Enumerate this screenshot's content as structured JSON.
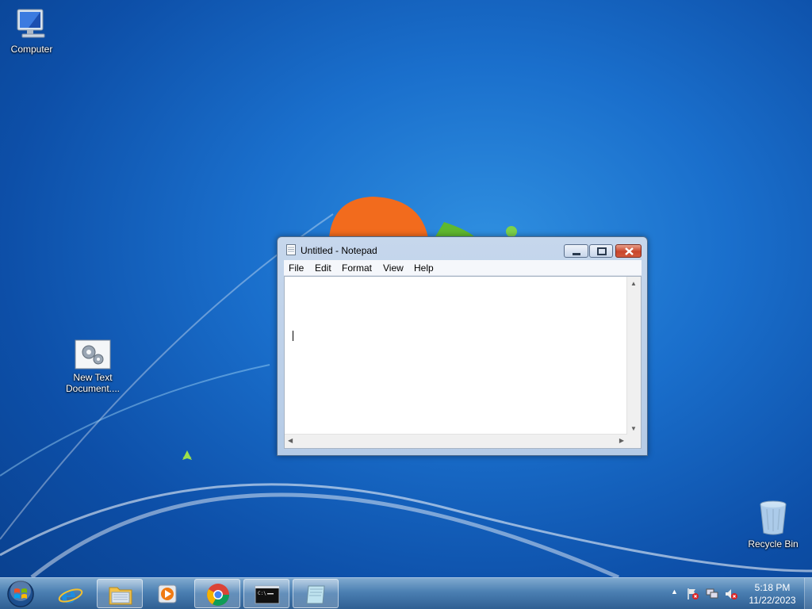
{
  "desktop": {
    "icons": [
      {
        "label": "Computer"
      },
      {
        "label": "New Text Document...."
      },
      {
        "label": "Recycle Bin"
      }
    ]
  },
  "notepad": {
    "title": "Untitled - Notepad",
    "menu": [
      "File",
      "Edit",
      "Format",
      "View",
      "Help"
    ],
    "content": ""
  },
  "taskbar": {
    "pinned": [
      "start-button",
      "internet-explorer",
      "windows-explorer",
      "media-player",
      "chrome",
      "command-prompt",
      "notepad"
    ],
    "active": "notepad",
    "clock": {
      "time": "5:18 PM",
      "date": "11/22/2023"
    }
  },
  "colors": {
    "accent": "#1a6fcc",
    "close": "#c8462c"
  }
}
